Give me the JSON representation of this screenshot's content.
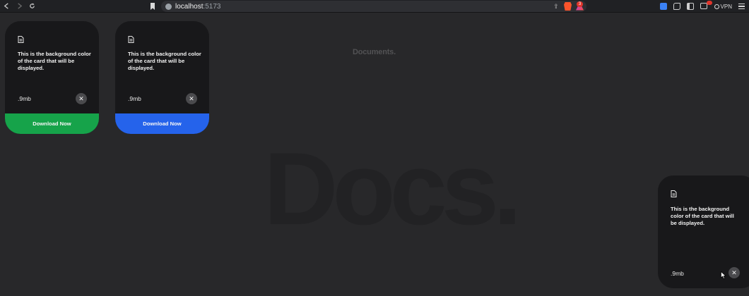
{
  "browser": {
    "url_host": "localhost",
    "url_port": ":5173",
    "rewards_count": "3",
    "vpn_label": "VPN",
    "icons": [
      "back-icon",
      "forward-icon",
      "reload-icon",
      "bookmark-icon",
      "site-info-icon",
      "share-icon",
      "brave-shields-icon",
      "brave-rewards-icon",
      "extension-icon",
      "puzzle-icon",
      "sidebar-icon",
      "wallet-icon",
      "globe-icon",
      "menu-icon"
    ]
  },
  "page": {
    "section_title": "Documents.",
    "watermark": "Docs."
  },
  "cards": [
    {
      "description": "This is the background color of the card that will be displayed.",
      "size": ".9mb",
      "close_glyph": "✕",
      "download_label": "Download Now",
      "download_color": "#16a34a"
    },
    {
      "description": "This is the background color of the card that will be displayed.",
      "size": ".9mb",
      "close_glyph": "✕",
      "download_label": "Download Now",
      "download_color": "#2563eb"
    },
    {
      "description": "This is the background color of the card that will be displayed.",
      "size": ".9mb",
      "close_glyph": "✕"
    }
  ],
  "colors": {
    "page_bg": "#28282a",
    "card_bg": "#18181a",
    "green": "#16a34a",
    "blue": "#2563eb"
  }
}
